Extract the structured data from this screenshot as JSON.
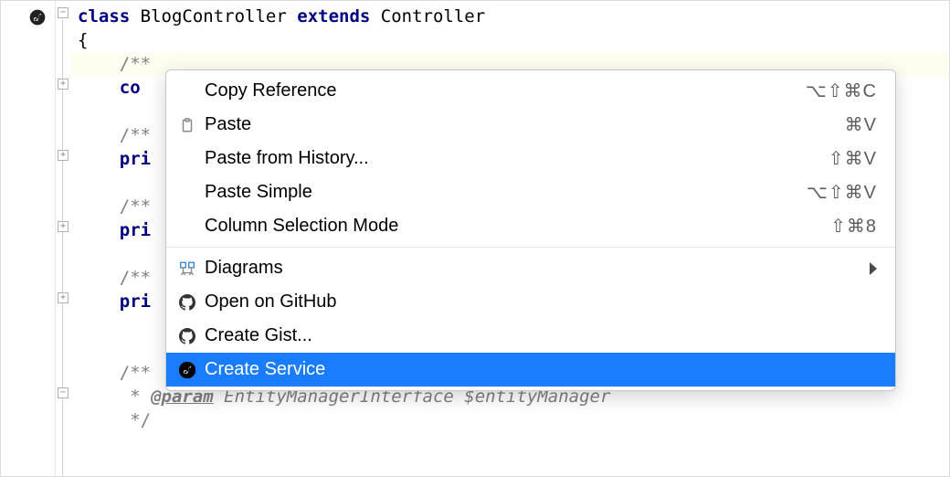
{
  "code": {
    "line1": {
      "kw_class": "class",
      "name": "BlogController",
      "kw_extends": "extends",
      "parent": "Controller"
    },
    "line2": "{",
    "line3_comment": "/**",
    "line4_prefix": "co",
    "line6_comment": "/**",
    "line7_prefix": "pri",
    "line9_comment": "/**",
    "line10_prefix": "pri",
    "line12_comment": "/**",
    "line13_prefix": "pri",
    "line15_comment": "/**",
    "line16_star": " * ",
    "line16_tag": "@param",
    "line16_rest": " EntityManagerInterface $entityManager",
    "line17": " */"
  },
  "menu": {
    "items": [
      {
        "label": "Copy Reference",
        "shortcut": "⌥⇧⌘C",
        "icon": ""
      },
      {
        "label": "Paste",
        "shortcut": "⌘V",
        "icon": "paste"
      },
      {
        "label": "Paste from History...",
        "shortcut": "⇧⌘V",
        "icon": ""
      },
      {
        "label": "Paste Simple",
        "shortcut": "⌥⇧⌘V",
        "icon": ""
      },
      {
        "label": "Column Selection Mode",
        "shortcut": "⇧⌘8",
        "icon": ""
      }
    ],
    "items2": [
      {
        "label": "Diagrams",
        "shortcut": "",
        "icon": "diagram",
        "submenu": true
      },
      {
        "label": "Open on GitHub",
        "shortcut": "",
        "icon": "github"
      },
      {
        "label": "Create Gist...",
        "shortcut": "",
        "icon": "github"
      },
      {
        "label": "Create Service",
        "shortcut": "",
        "icon": "symfony",
        "selected": true
      }
    ]
  }
}
